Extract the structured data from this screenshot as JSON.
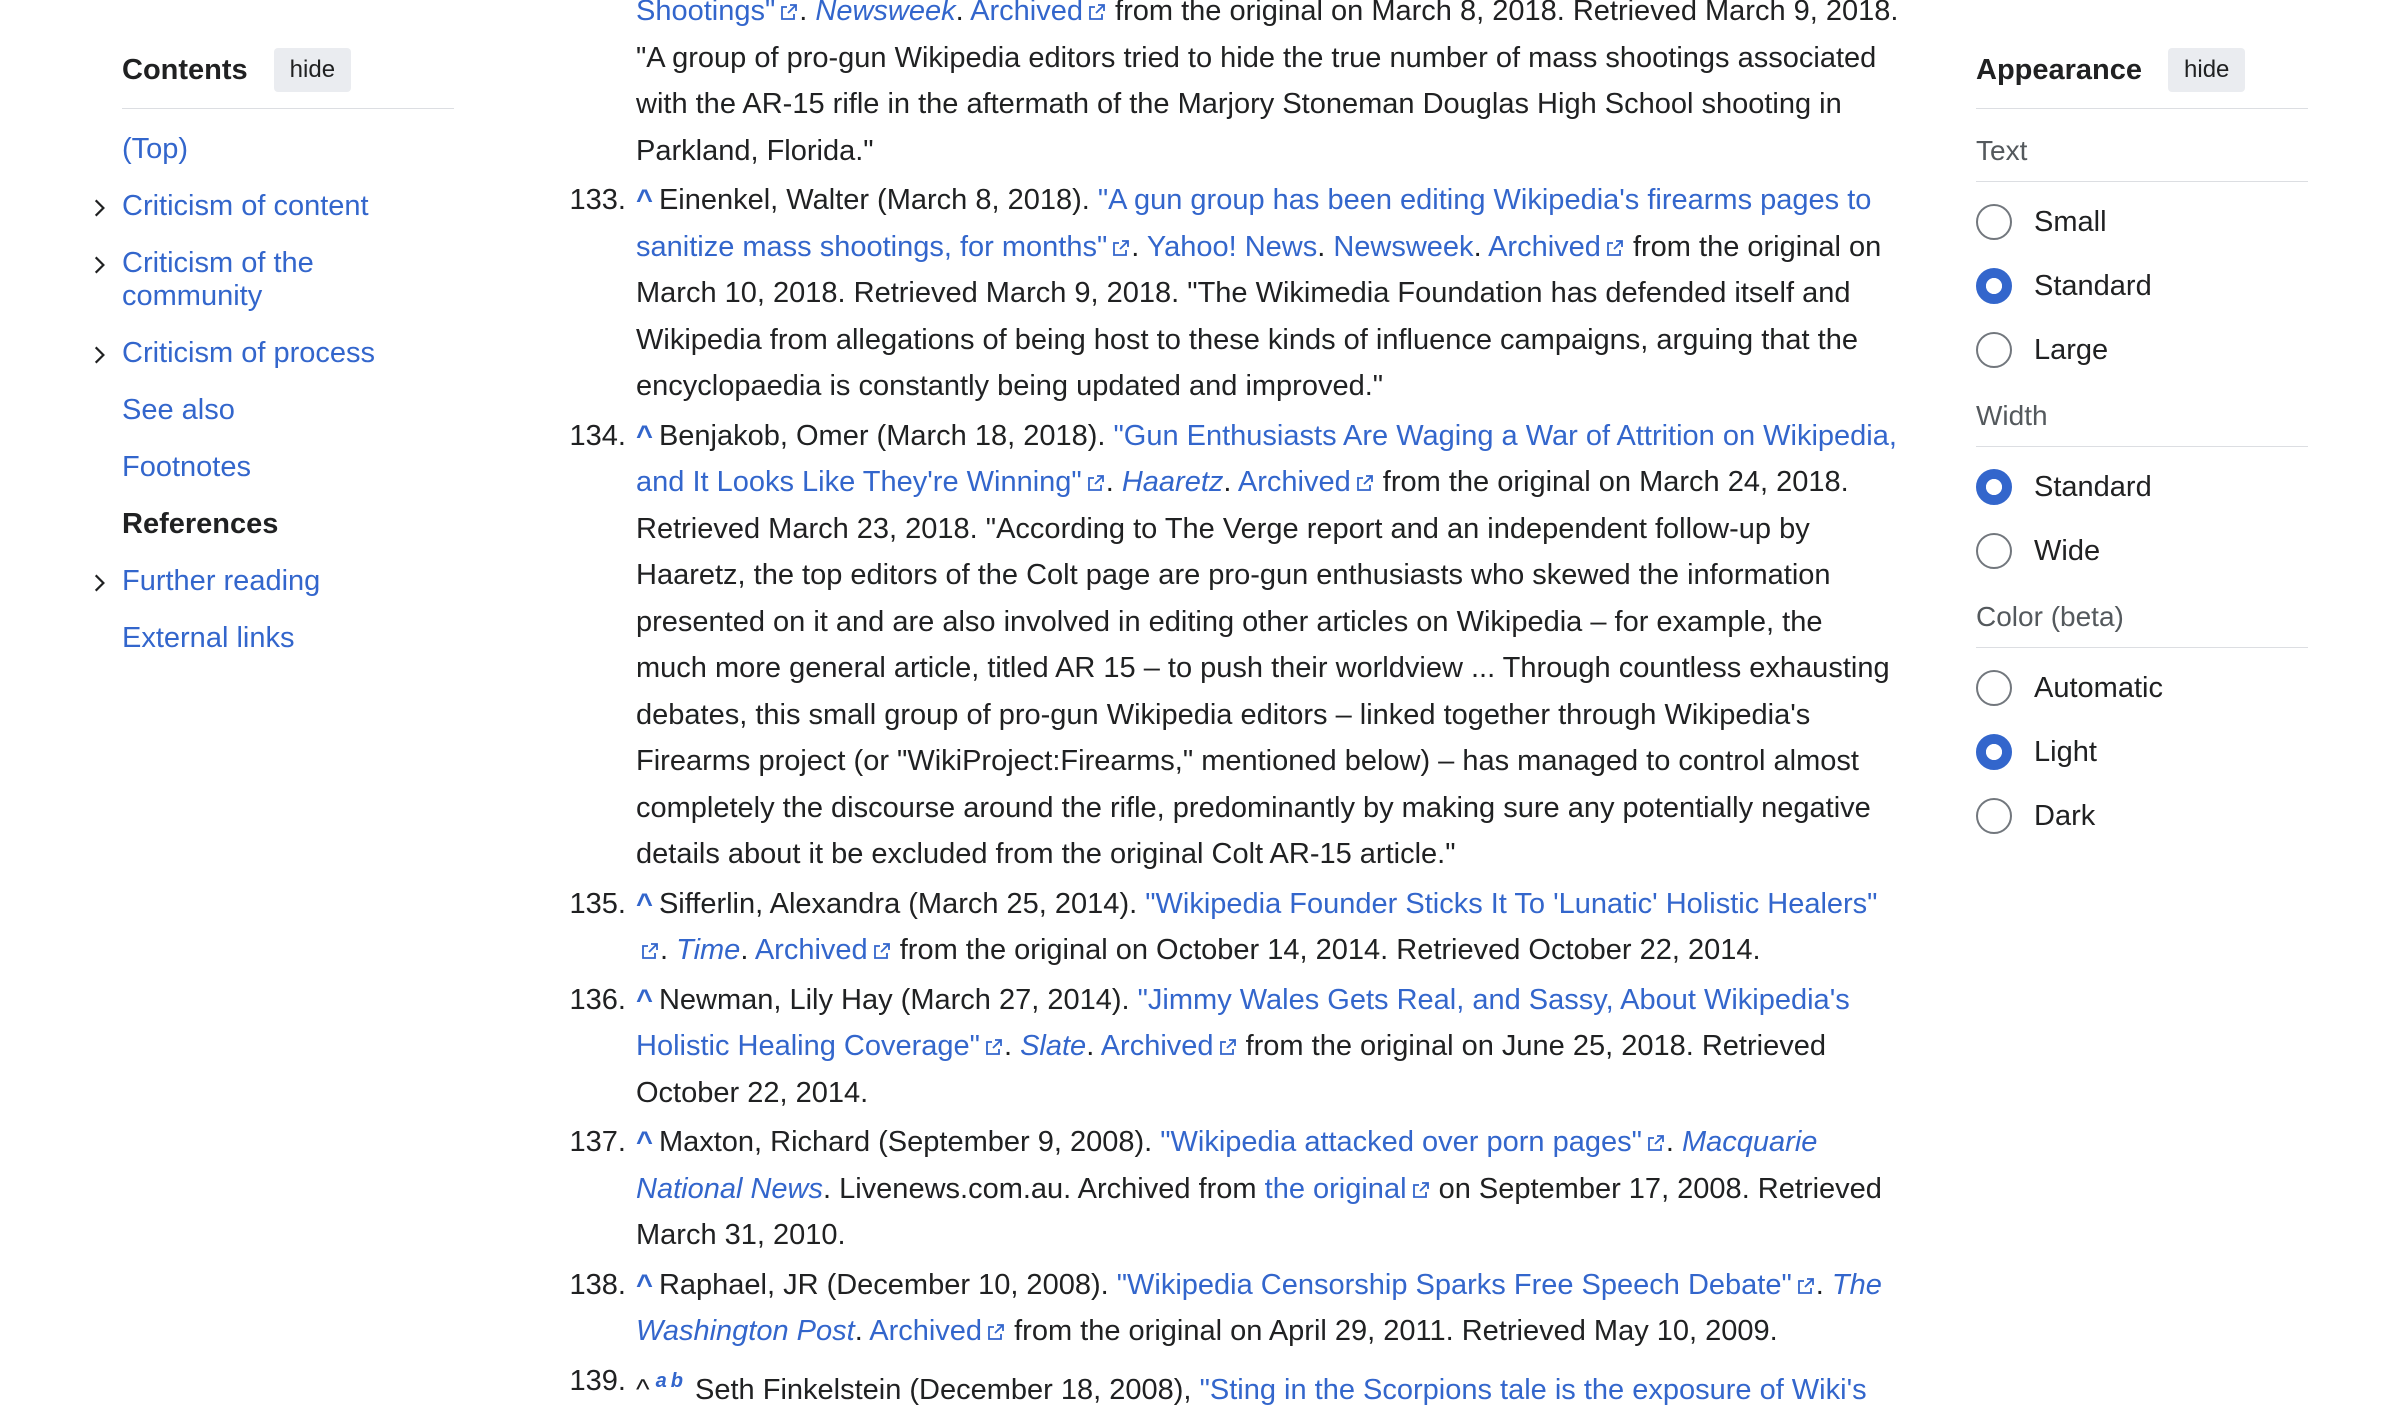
{
  "toc": {
    "title": "Contents",
    "hide_label": "hide",
    "items": [
      {
        "label": "(Top)"
      },
      {
        "label": "Criticism of content"
      },
      {
        "label": "Criticism of the community"
      },
      {
        "label": "Criticism of process"
      },
      {
        "label": "See also"
      },
      {
        "label": "Footnotes"
      },
      {
        "label": "References"
      },
      {
        "label": "Further reading"
      },
      {
        "label": "External links"
      }
    ]
  },
  "refs": {
    "r132": {
      "link": "Shootings\"",
      "pub": "Newsweek",
      "archived": "Archived",
      "tail": "from the original on March 8, 2018. Retrieved March 9, 2018. \"A group of pro-gun Wikipedia editors tried to hide the true number of mass shootings associated with the AR-15 rifle in the aftermath of the Marjory Stoneman Douglas High School shooting in Parkland, Florida.\""
    },
    "r133": {
      "num": "133.",
      "caret": "^",
      "author": "Einenkel, Walter (March 8, 2018).",
      "title": "\"A gun group has been editing Wikipedia's firearms pages to sanitize mass shootings, for months\"",
      "publisher": "Yahoo! News",
      "pub2": "Newsweek",
      "archived": "Archived",
      "tail": "from the original on March 10, 2018. Retrieved March 9, 2018. \"The Wikimedia Foundation has defended itself and Wikipedia from allegations of being host to these kinds of influence campaigns, arguing that the encyclopaedia is constantly being updated and improved.\""
    },
    "r134": {
      "num": "134.",
      "caret": "^",
      "author": "Benjakob, Omer (March 18, 2018).",
      "title": "\"Gun Enthusiasts Are Waging a War of Attrition on Wikipedia, and It Looks Like They're Winning\"",
      "pub": "Haaretz",
      "archived": "Archived",
      "tail": "from the original on March 24, 2018. Retrieved March 23, 2018. \"According to The Verge report and an independent follow-up by Haaretz, the top editors of the Colt page are pro-gun enthusiasts who skewed the information presented on it and are also involved in editing other articles on Wikipedia – for example, the much more general article, titled AR 15 – to push their worldview ... Through countless exhausting debates, this small group of pro-gun Wikipedia editors – linked together through Wikipedia's Firearms project (or \"WikiProject:Firearms,\" mentioned below) – has managed to control almost completely the discourse around the rifle, predominantly by making sure any potentially negative details about it be excluded from the original Colt AR-15 article.\""
    },
    "r135": {
      "num": "135.",
      "caret": "^",
      "author": "Sifferlin, Alexandra (March 25, 2014).",
      "title": "\"Wikipedia Founder Sticks It To 'Lunatic' Holistic Healers\"",
      "pub": "Time",
      "archived": "Archived",
      "tail": "from the original on October 14, 2014. Retrieved October 22, 2014."
    },
    "r136": {
      "num": "136.",
      "caret": "^",
      "author": "Newman, Lily Hay (March 27, 2014).",
      "title": "\"Jimmy Wales Gets Real, and Sassy, About Wikipedia's Holistic Healing Coverage\"",
      "pub": "Slate",
      "archived": "Archived",
      "tail": "from the original on June 25, 2018. Retrieved October 22, 2014."
    },
    "r137": {
      "num": "137.",
      "caret": "^",
      "author": "Maxton, Richard (September 9, 2008).",
      "title": "\"Wikipedia attacked over porn pages\"",
      "pub": "Macquarie National News",
      "mid": "Livenews.com.au. Archived from",
      "orig_link": "the original",
      "tail": "on September 17, 2008. Retrieved March 31, 2010."
    },
    "r138": {
      "num": "138.",
      "caret": "^",
      "author": "Raphael, JR (December 10, 2008).",
      "title": "\"Wikipedia Censorship Sparks Free Speech Debate\"",
      "pub": "The Washington Post",
      "archived": "Archived",
      "tail": "from the original on April 29, 2011. Retrieved May 10, 2009."
    },
    "r139": {
      "num": "139.",
      "caret": "^",
      "sup_a": "a",
      "sup_b": "b",
      "author": "Seth Finkelstein (December 18, 2008),",
      "title": "\"Sting in the Scorpions tale is the exposure of Wiki's"
    }
  },
  "appearance": {
    "title": "Appearance",
    "hide_label": "hide",
    "text": {
      "label": "Text",
      "options": [
        "Small",
        "Standard",
        "Large"
      ],
      "selected": "Standard"
    },
    "width": {
      "label": "Width",
      "options": [
        "Standard",
        "Wide"
      ],
      "selected": "Standard"
    },
    "color": {
      "label": "Color (beta)",
      "options": [
        "Automatic",
        "Light",
        "Dark"
      ],
      "selected": "Light"
    }
  },
  "colors": {
    "link": "#3366cc",
    "text": "#202122",
    "accent": "#3366cc"
  }
}
